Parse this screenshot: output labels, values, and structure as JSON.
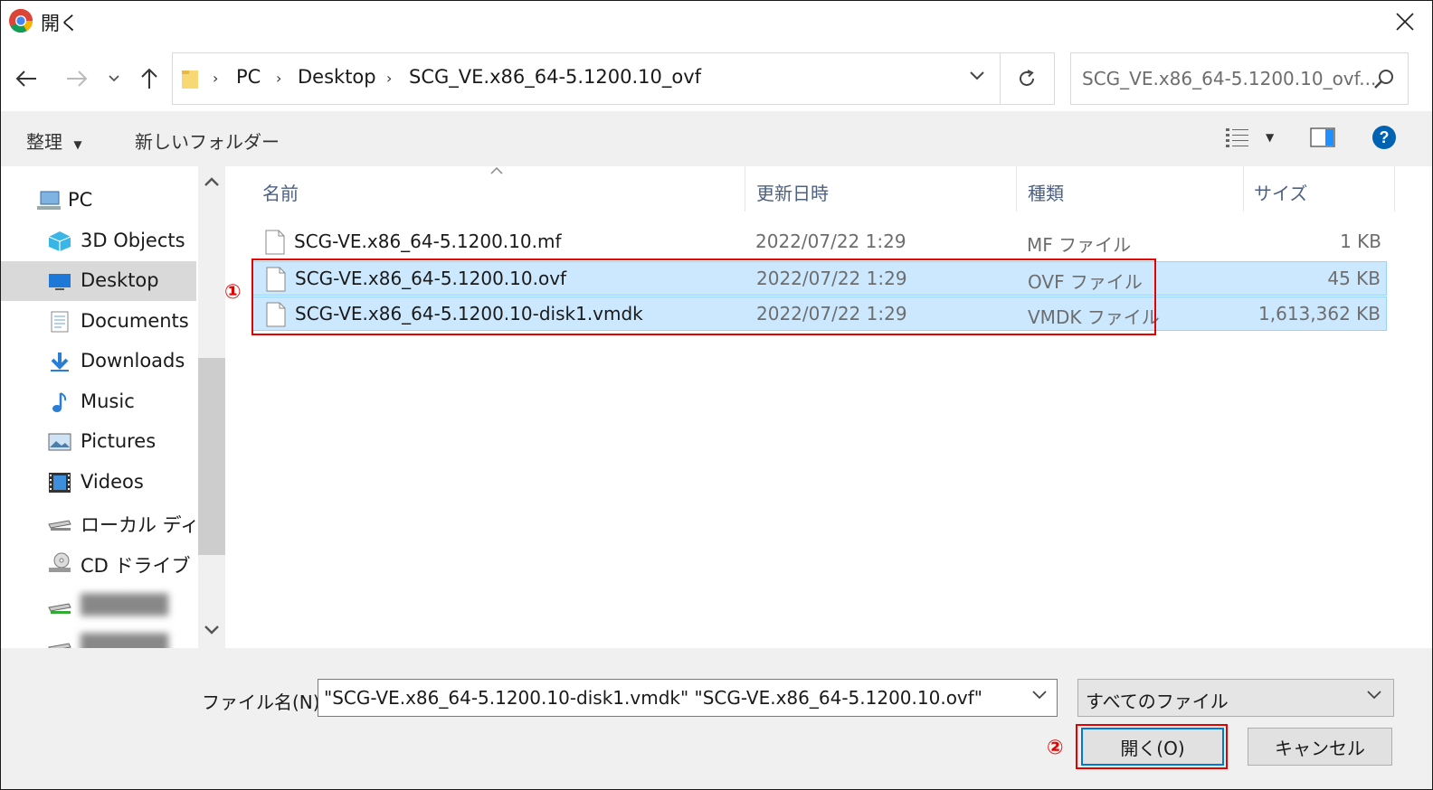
{
  "window": {
    "title": "開く",
    "colors": {
      "accent": "#0078d7",
      "selection": "#cce8ff",
      "annotation": "#e60000"
    }
  },
  "address": {
    "breadcrumbs": [
      "PC",
      "Desktop",
      "SCG_VE.x86_64-5.1200.10_ovf"
    ]
  },
  "search": {
    "placeholder": "SCG_VE.x86_64-5.1200.10_ovf..."
  },
  "toolbar": {
    "organize_label": "整理",
    "new_folder_label": "新しいフォルダー"
  },
  "nav": {
    "root": "PC",
    "items": [
      {
        "label": "3D Objects",
        "icon": "3d-objects-icon"
      },
      {
        "label": "Desktop",
        "icon": "desktop-icon",
        "selected": true
      },
      {
        "label": "Documents",
        "icon": "documents-icon"
      },
      {
        "label": "Downloads",
        "icon": "downloads-icon"
      },
      {
        "label": "Music",
        "icon": "music-icon"
      },
      {
        "label": "Pictures",
        "icon": "pictures-icon"
      },
      {
        "label": "Videos",
        "icon": "videos-icon"
      },
      {
        "label": "ローカル ディスク",
        "icon": "local-disk-icon"
      },
      {
        "label": "CD ドライブ (D",
        "icon": "cd-drive-icon"
      }
    ]
  },
  "filelist": {
    "columns": [
      "名前",
      "更新日時",
      "種類",
      "サイズ"
    ],
    "rows": [
      {
        "name": "SCG-VE.x86_64-5.1200.10.mf",
        "date": "2022/07/22 1:29",
        "type": "MF ファイル",
        "size": "1 KB",
        "selected": false
      },
      {
        "name": "SCG-VE.x86_64-5.1200.10.ovf",
        "date": "2022/07/22 1:29",
        "type": "OVF ファイル",
        "size": "45 KB",
        "selected": true
      },
      {
        "name": "SCG-VE.x86_64-5.1200.10-disk1.vmdk",
        "date": "2022/07/22 1:29",
        "type": "VMDK ファイル",
        "size": "1,613,362 KB",
        "selected": true
      }
    ]
  },
  "footer": {
    "filename_label": "ファイル名(N):",
    "filename_value": "\"SCG-VE.x86_64-5.1200.10-disk1.vmdk\" \"SCG-VE.x86_64-5.1200.10.ovf\"",
    "filetype_value": "すべてのファイル",
    "open_label": "開く(O)",
    "cancel_label": "キャンセル"
  },
  "annotations": {
    "step1": "①",
    "step2": "②"
  }
}
